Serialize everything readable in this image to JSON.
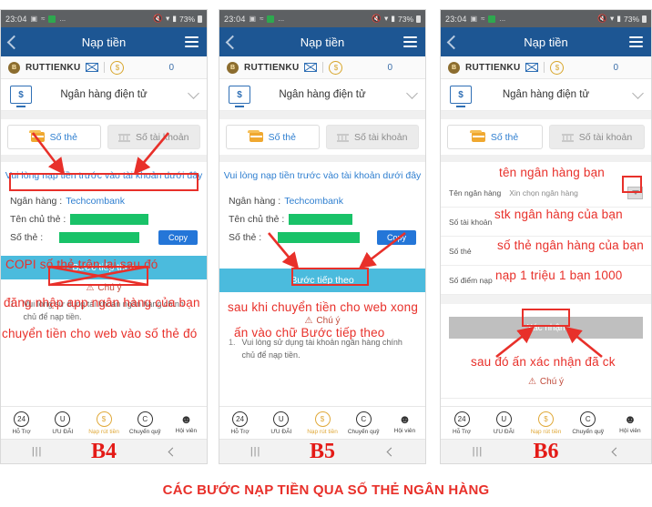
{
  "caption": "CÁC BƯỚC NẠP TIỀN QUA SỐ THẺ NGÂN HÀNG",
  "statusbar": {
    "time": "23:04",
    "dots": "...",
    "battery": "73%"
  },
  "header": {
    "title": "Nạp tiền",
    "back_icon": "chevron-left-icon",
    "menu_icon": "hamburger-icon"
  },
  "account": {
    "avatar_letter": "B",
    "username": "RUTTIENKU",
    "mail_icon": "mail-icon",
    "coin_icon": "coin-icon",
    "balance": "0"
  },
  "bank_select": {
    "icon": "monitor-dollar-icon",
    "label": "Ngân hàng điện tử",
    "chevron": "chevron-down-icon"
  },
  "tabs": {
    "card": "Số thẻ",
    "account": "Số tài khoản"
  },
  "notice": "Vui lòng nạp tiền trước vào tài khoản dưới đây",
  "info": {
    "bank_label": "Ngân hàng :",
    "bank_value": "Techcombank",
    "holder_label": "Tên chủ thẻ :",
    "card_label": "Số thẻ :",
    "copy": "Copy"
  },
  "cta_label": "Bước tiếp theo",
  "attention": {
    "icon": "warning-triangle-icon",
    "label": "Chú ý"
  },
  "notes": [
    {
      "num": "1.",
      "text": "Vui lòng sử dụng tài khoản ngân hàng chính chủ để nạp tiền."
    }
  ],
  "bottom_nav": [
    {
      "icon": "support-24-icon",
      "label": "Hỗ Trợ",
      "glyph": "24",
      "active": false
    },
    {
      "icon": "promo-u-icon",
      "label": "ƯU ĐÃI",
      "glyph": "U",
      "active": false
    },
    {
      "icon": "deposit-dollar-icon",
      "label": "Nạp rút tiền",
      "glyph": "$",
      "active": true
    },
    {
      "icon": "transfer-c-icon",
      "label": "Chuyển quỹ",
      "glyph": "C",
      "active": false
    },
    {
      "icon": "member-person-icon",
      "label": "Hội viên",
      "glyph": "person",
      "active": false
    }
  ],
  "sysbar": {
    "recents_icon": "recents-icon",
    "recents_glyph": "|||",
    "back_icon": "back-chevron-icon"
  },
  "panels": [
    {
      "step": "B4",
      "annotations": [
        "Vui lòng nạp tiền trước vào tài khoản dưới đây",
        "COPI số thẻ trên lại sau đó",
        "đăng nhập app ngân hàng của bạn",
        "chuyển tiền cho web vào số thẻ đó"
      ]
    },
    {
      "step": "B5",
      "annotations": [
        "sau khi chuyển tiền cho web xong",
        "ấn vào chữ Bước tiếp theo"
      ]
    },
    {
      "step": "B6",
      "annotations": [
        "tên ngân hàng bạn",
        "stk ngân hàng của bạn",
        "số thẻ ngân hàng của bạn",
        "nạp 1 triệu 1 bạn 1000",
        "sau đó ấn xác nhận đã ck"
      ],
      "form_rows": [
        {
          "label": "Tên ngân hàng",
          "placeholder": "Xin chọn ngân hàng",
          "dropdown": true
        },
        {
          "label": "Số tài khoản",
          "placeholder": "",
          "dropdown": false
        },
        {
          "label": "Số thẻ",
          "placeholder": "",
          "dropdown": false
        },
        {
          "label": "Số điểm nạp",
          "placeholder": "",
          "dropdown": false
        }
      ],
      "confirm_label": "Xác nhận"
    }
  ]
}
